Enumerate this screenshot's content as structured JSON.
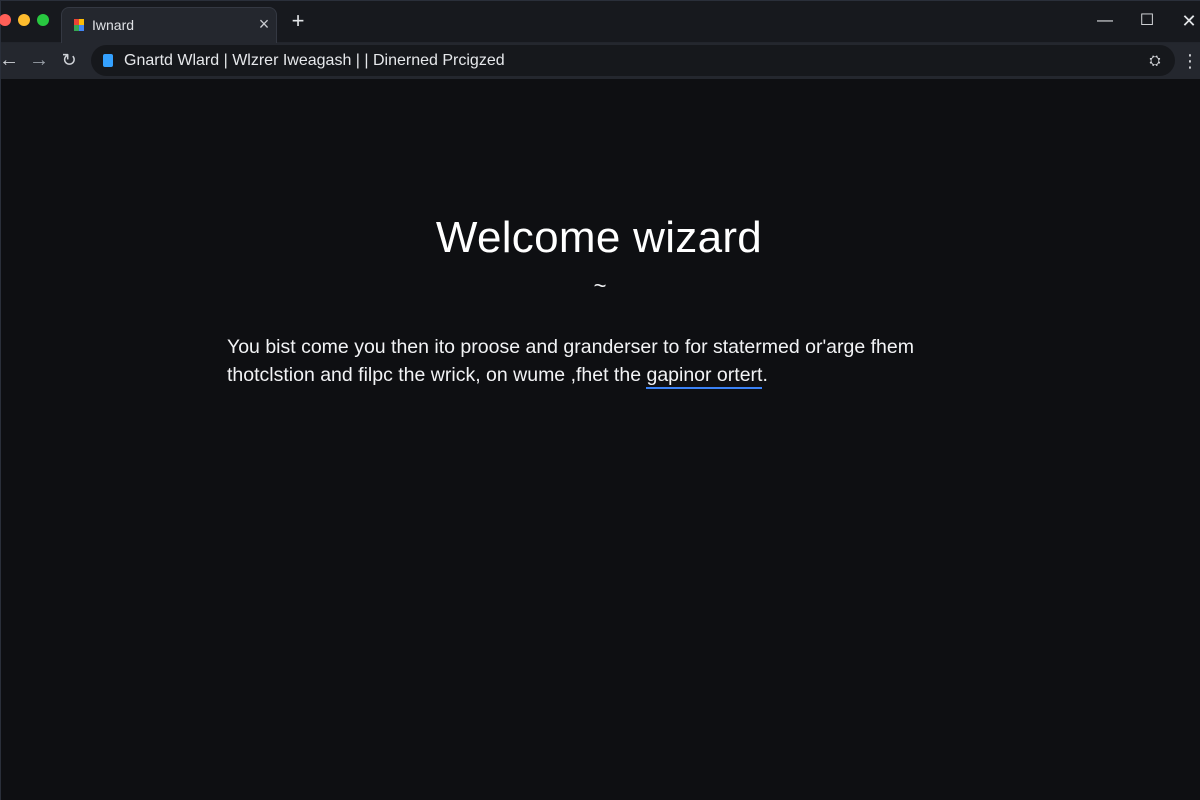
{
  "browser": {
    "tab": {
      "title": "Iwnard",
      "close_glyph": "×",
      "favicon_colors": [
        "#ea4335",
        "#fbbc05",
        "#34a853",
        "#4285f4"
      ]
    },
    "new_tab_glyph": "+",
    "window_controls": {
      "minimize": "—",
      "maximize": "☐",
      "close": "✕"
    },
    "nav": {
      "back": "←",
      "forward": "→",
      "reload": "↻"
    },
    "address_bar": {
      "text": "Gnartd Wlard | Wlzrer Iweagash | | Dinerned Prcigzed",
      "extension_glyph": "⛭"
    },
    "menu_glyph": "⋮"
  },
  "page": {
    "title": "Welcome wizard",
    "divider": "~",
    "paragraph_line1": "You bist come you then ito proose and granderser to for statermed or'arge fhem",
    "paragraph_line2_prefix": "thotclstion and filpc the wrick, on wume ,fhet the ",
    "paragraph_link": "gapinor ortert",
    "paragraph_line2_suffix": ".",
    "link_color": "#3b82f6",
    "background_color": "#0e0f12"
  }
}
